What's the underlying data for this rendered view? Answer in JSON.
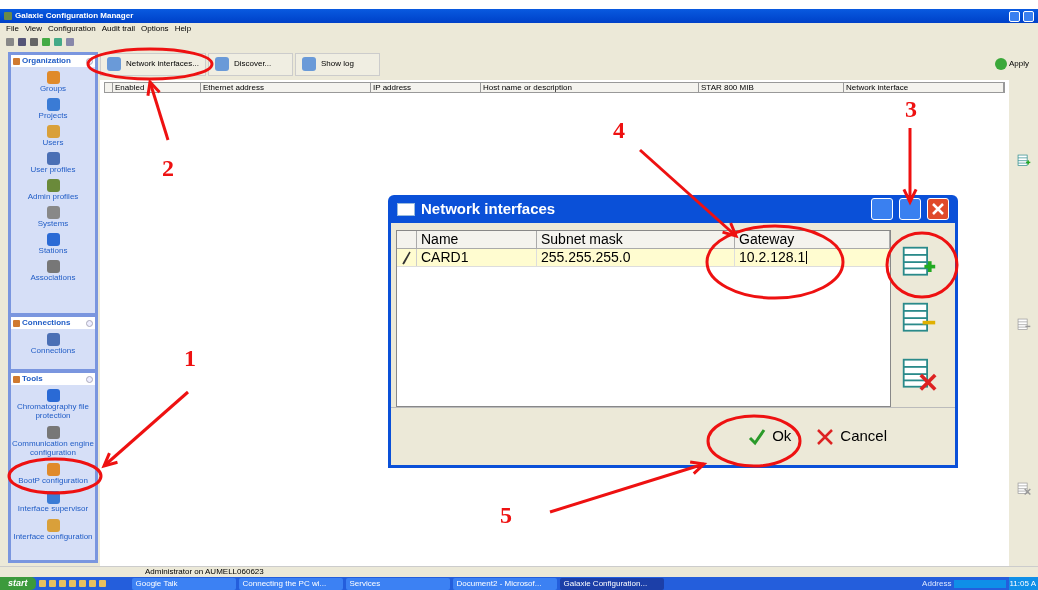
{
  "window": {
    "title": "Galaxie Configuration Manager"
  },
  "menu": [
    "File",
    "View",
    "Configuration",
    "Audit trail",
    "Options",
    "Help"
  ],
  "toolbar_buttons": [
    "Network interfaces...",
    "Discover...",
    "Show log"
  ],
  "apply_button": "Apply",
  "sidebar": [
    {
      "title": "Organization",
      "items": [
        "Groups",
        "Projects",
        "Users",
        "User profiles",
        "Admin profiles",
        "Systems",
        "Stations",
        "Associations"
      ]
    },
    {
      "title": "Connections",
      "items": [
        "Connections"
      ]
    },
    {
      "title": "Tools",
      "items": [
        "Chromatography file protection",
        "Communication engine configuration",
        "BootP configuration",
        "Interface supervisor",
        "Interface configuration"
      ]
    }
  ],
  "table": {
    "columns": [
      "Enabled",
      "Ethernet address",
      "IP address",
      "Host name or description",
      "STAR 800 MIB",
      "Network interface"
    ]
  },
  "side_actions": [
    {
      "kind": "add",
      "disabled": false
    },
    {
      "kind": "remove",
      "disabled": true
    },
    {
      "kind": "delete",
      "disabled": true
    }
  ],
  "dialog": {
    "title": "Network interfaces",
    "columns": [
      "Name",
      "Subnet mask",
      "Gateway"
    ],
    "rows": [
      {
        "editing": true,
        "cells": [
          "CARD1",
          "255.255.255.0",
          "10.2.128.1"
        ]
      }
    ],
    "actions": [
      {
        "kind": "add"
      },
      {
        "kind": "remove"
      },
      {
        "kind": "delete"
      }
    ],
    "ok": "Ok",
    "cancel": "Cancel"
  },
  "status_bar": "Administrator on AUMELL060623",
  "taskbar": {
    "start": "start",
    "tasks": [
      {
        "label": "Google Talk",
        "selected": false
      },
      {
        "label": "Connecting the PC wi...",
        "selected": false
      },
      {
        "label": "Services",
        "selected": false
      },
      {
        "label": "Document2 - Microsof...",
        "selected": false
      },
      {
        "label": "Galaxie Configuration...",
        "selected": true
      }
    ],
    "address": "Address",
    "clock": "11:05 A"
  },
  "annotations": [
    {
      "label": "1"
    },
    {
      "label": "2"
    },
    {
      "label": "3"
    },
    {
      "label": "4"
    },
    {
      "label": "5"
    }
  ]
}
